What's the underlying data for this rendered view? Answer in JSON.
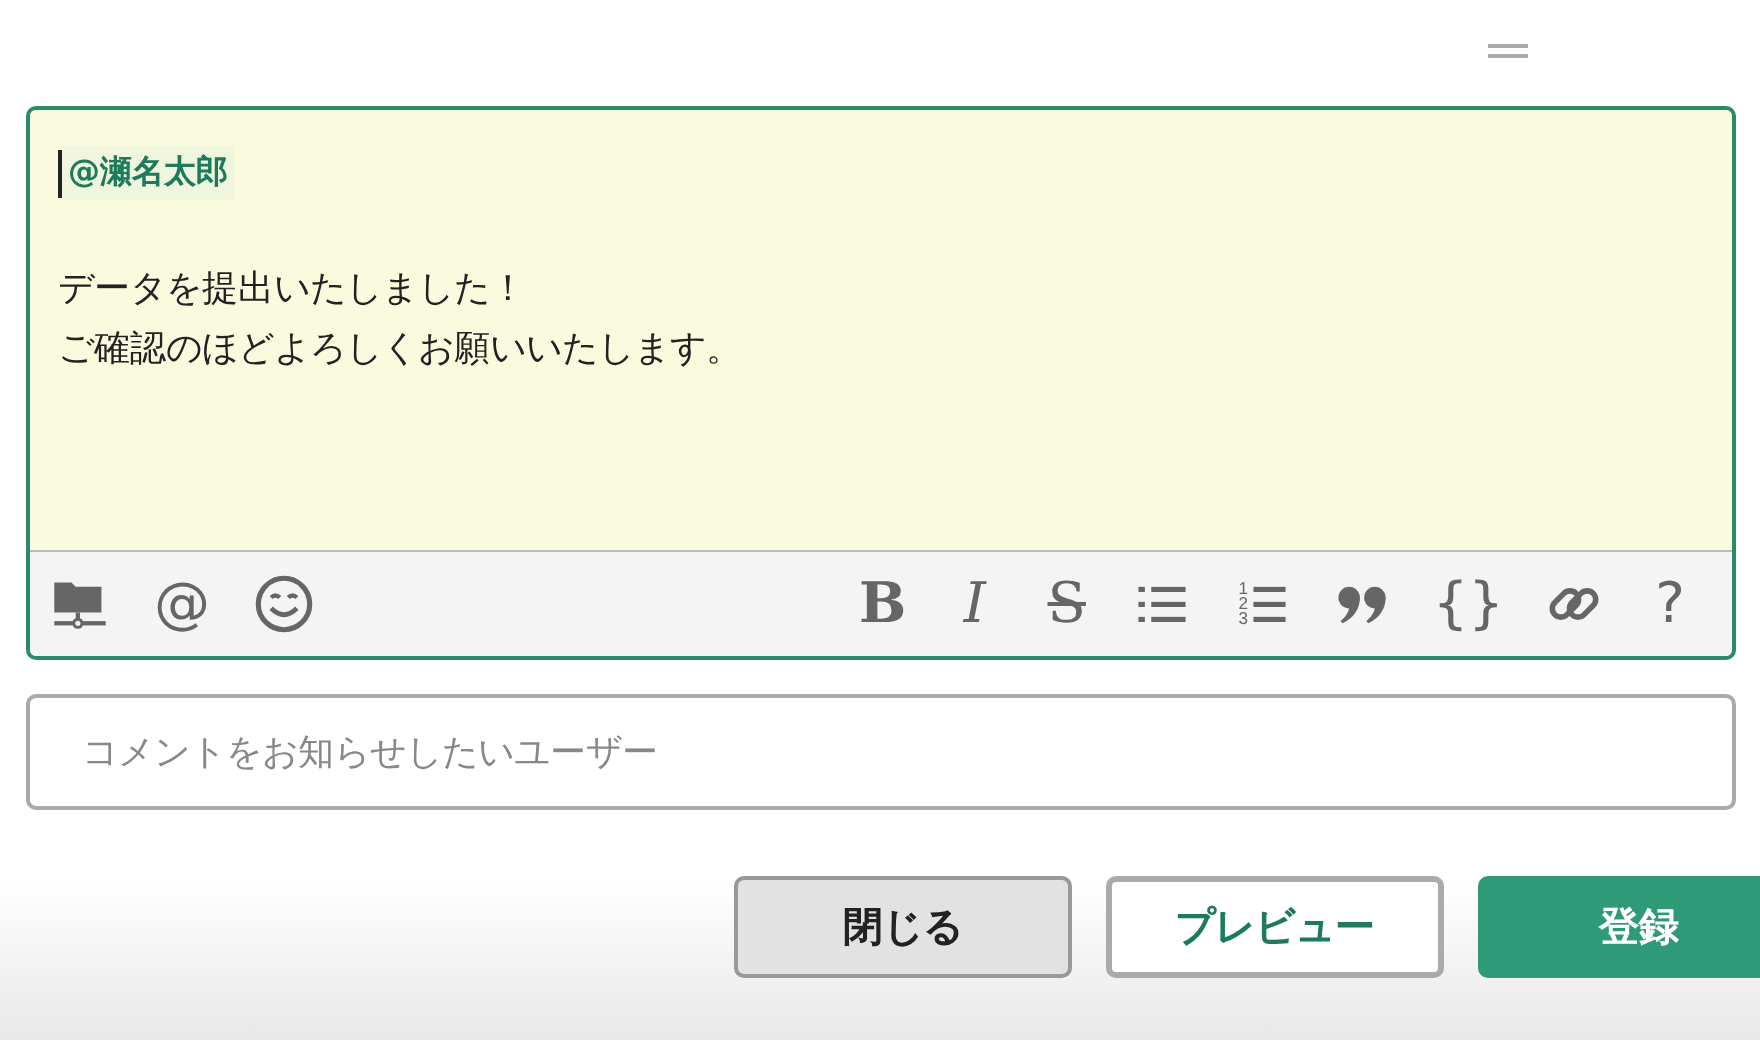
{
  "editor": {
    "mention": "@瀬名太郎",
    "lines": [
      "データを提出いたしました！",
      "ご確認のほどよろしくお願いいたします。"
    ],
    "toolbar_left": [
      {
        "kind": "folder"
      },
      {
        "kind": "glyph",
        "text": "@"
      },
      {
        "kind": "smiley"
      }
    ],
    "toolbar_right": [
      {
        "kind": "bold",
        "text": "B"
      },
      {
        "kind": "italic",
        "text": "I"
      },
      {
        "kind": "strike",
        "text": "S"
      },
      {
        "kind": "bullets"
      },
      {
        "kind": "numbers",
        "digits": [
          "1",
          "2",
          "3"
        ]
      },
      {
        "kind": "quote"
      },
      {
        "kind": "glyph",
        "text": "{}"
      },
      {
        "kind": "link"
      },
      {
        "kind": "glyph",
        "text": "?"
      }
    ]
  },
  "notify_field": {
    "placeholder": "コメントをお知らせしたいユーザー"
  },
  "buttons": [
    {
      "label": "閉じる",
      "kind": "secondary"
    },
    {
      "label": "プレビュー",
      "kind": "outline"
    },
    {
      "label": "登録",
      "kind": "primary"
    }
  ]
}
